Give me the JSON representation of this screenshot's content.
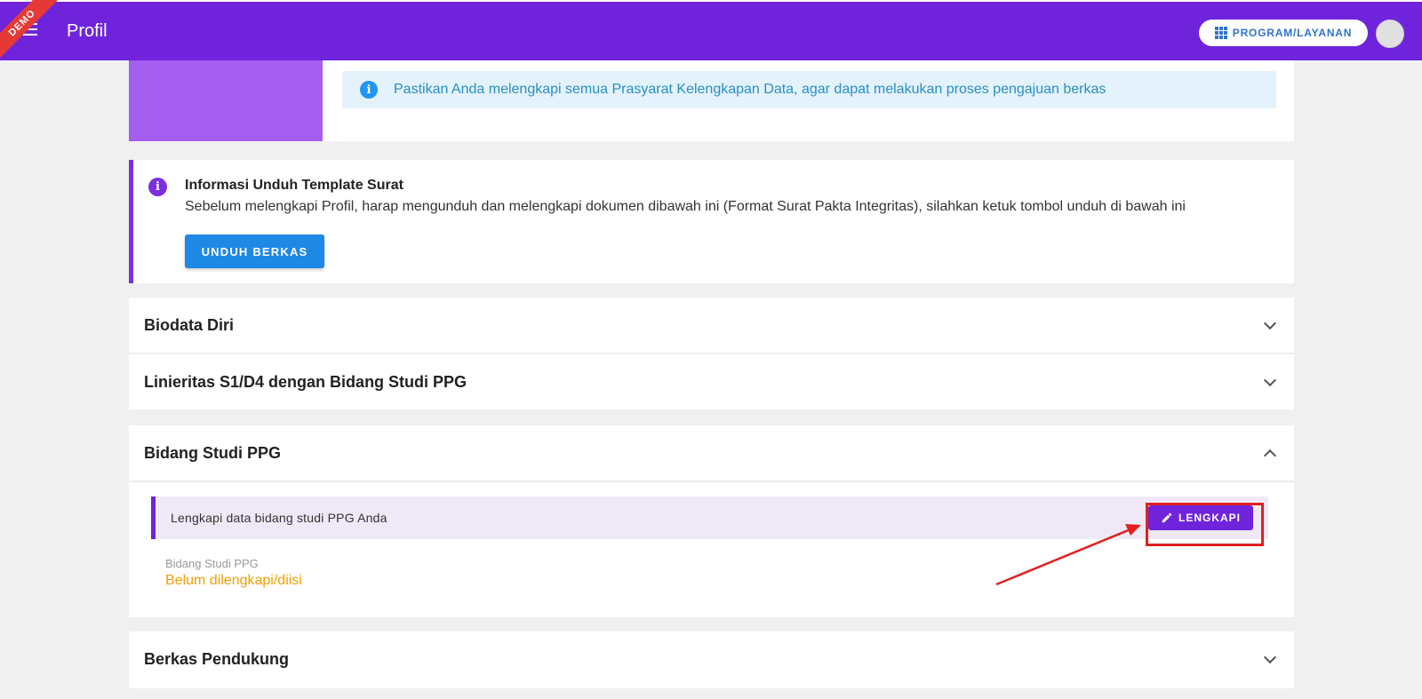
{
  "header": {
    "demo_badge": "DEMO",
    "title": "Profil",
    "program_button": "PROGRAM/LAYANAN",
    "bg_color": "#6f24dc"
  },
  "info_alert": {
    "icon": "info-icon",
    "text": "Pastikan Anda melengkapi semua Prasyarat Kelengkapan Data, agar dapat melakukan proses pengajuan berkas"
  },
  "template_info": {
    "icon": "info-icon",
    "title": "Informasi Unduh Template Surat",
    "description": "Sebelum melengkapi Profil, harap mengunduh dan melengkapi dokumen dibawah ini (Format Surat Pakta Integritas), silahkan ketuk tombol unduh di bawah ini",
    "button_label": "UNDUH BERKAS"
  },
  "panels": {
    "biodata": {
      "title": "Biodata Diri",
      "expanded": false
    },
    "linieritas": {
      "title": "Linieritas S1/D4 dengan Bidang Studi PPG",
      "expanded": false
    },
    "bidang_studi": {
      "title": "Bidang Studi PPG",
      "expanded": true,
      "notice_text": "Lengkapi data bidang studi PPG Anda",
      "button_label": "LENGKAPI",
      "button_icon": "pencil-icon",
      "field_label": "Bidang Studi PPG",
      "field_value": "Belum dilengkapi/diisi",
      "field_value_color": "#f0a000"
    },
    "berkas": {
      "title": "Berkas Pendukung",
      "expanded": false
    }
  },
  "annotation": {
    "highlight_color": "#e02020"
  }
}
